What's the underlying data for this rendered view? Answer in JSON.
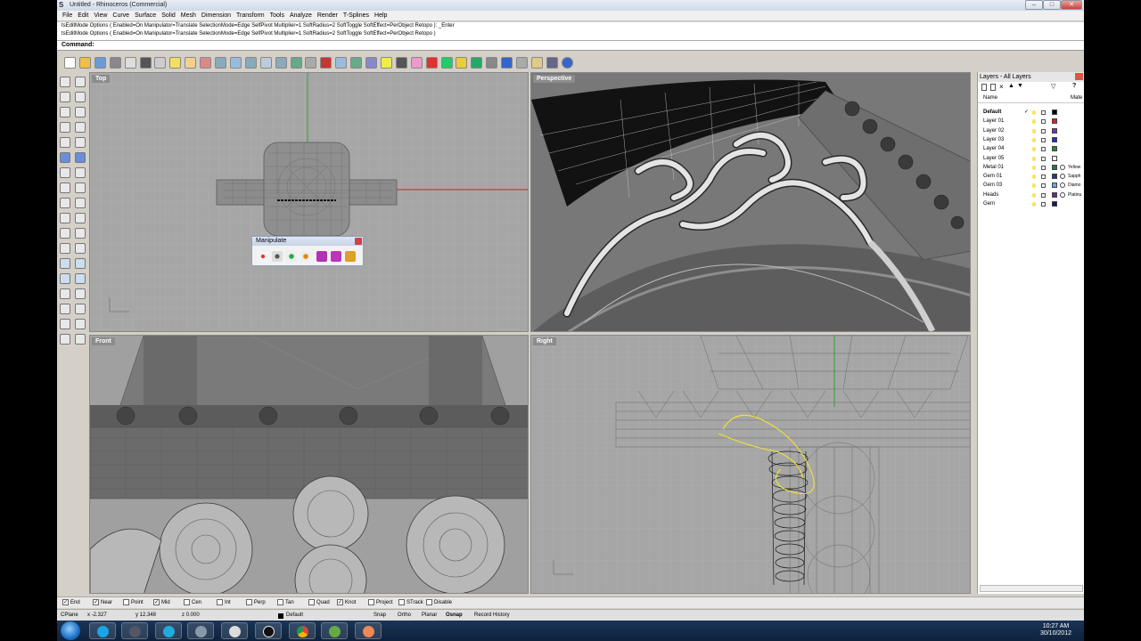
{
  "window": {
    "title": "Untitled - Rhinoceros (Commercial)",
    "logo": "S"
  },
  "menu": [
    "File",
    "Edit",
    "View",
    "Curve",
    "Surface",
    "Solid",
    "Mesh",
    "Dimension",
    "Transform",
    "Tools",
    "Analyze",
    "Render",
    "T-Splines",
    "Help"
  ],
  "command_history": [
    "tsEditMode Options ( Enabled=On  Manipulator=Translate  SelectionMode=Edge  SelfPivot  Multiplier=1  SoftRadius=2  SoftToggle  SoftEffect=PerObject  Retopo ): _Enter",
    "tsEditMode Options ( Enabled=On  Manipulator=Translate  SelectionMode=Edge  SelfPivot  Multiplier=1  SoftRadius=2  SoftToggle  SoftEffect=PerObject  Retopo )"
  ],
  "command_prompt": "Command:",
  "viewports": {
    "top": "Top",
    "perspective": "Perspective",
    "front": "Front",
    "right": "Right"
  },
  "manipulate": {
    "title": "Manipulate"
  },
  "layers": {
    "title": "Layers - All Layers",
    "columns": {
      "name": "Name",
      "material": "Mate"
    },
    "rows": [
      {
        "name": "Default",
        "current": true,
        "color": "#000000",
        "material": ""
      },
      {
        "name": "Layer 01",
        "color": "#e02020",
        "material": ""
      },
      {
        "name": "Layer 02",
        "color": "#7b2fa8",
        "material": ""
      },
      {
        "name": "Layer 03",
        "color": "#1c2fd8",
        "material": ""
      },
      {
        "name": "Layer 04",
        "color": "#2a8a2a",
        "material": ""
      },
      {
        "name": "Layer 05",
        "color": "#ffffff",
        "material": ""
      },
      {
        "name": "Metal 01",
        "color": "#1f7a4a",
        "material": "Yellow"
      },
      {
        "name": "Gem 01",
        "color": "#1e3a8a",
        "material": "Sapph"
      },
      {
        "name": "Gem 03",
        "color": "#6ba6e0",
        "material": "Diamo"
      },
      {
        "name": "Heads",
        "color": "#6a2a8a",
        "material": "Platinu"
      },
      {
        "name": "Gem",
        "color": "#1a1a5a",
        "material": ""
      }
    ],
    "current_mark": "✓"
  },
  "osnap": [
    {
      "label": "End",
      "checked": true
    },
    {
      "label": "Near",
      "checked": true
    },
    {
      "label": "Point",
      "checked": false
    },
    {
      "label": "Mid",
      "checked": true
    },
    {
      "label": "Cen",
      "checked": false
    },
    {
      "label": "Int",
      "checked": false
    },
    {
      "label": "Perp",
      "checked": false
    },
    {
      "label": "Tan",
      "checked": false
    },
    {
      "label": "Quad",
      "checked": false
    },
    {
      "label": "Knot",
      "checked": true
    },
    {
      "label": "Project",
      "checked": false
    },
    {
      "label": "STrack",
      "checked": false
    },
    {
      "label": "Disable",
      "checked": false
    }
  ],
  "status": {
    "cplane": "CPlane",
    "x": "x -2.327",
    "y": "y 12.348",
    "z": "z 0.000",
    "layer": "Default",
    "snap": "Snap",
    "ortho": "Ortho",
    "planar": "Planar",
    "osnap": "Osnap",
    "record": "Record History"
  },
  "clock": {
    "time": "10:27 AM",
    "date": "30/10/2012"
  },
  "check_mark": "✓"
}
